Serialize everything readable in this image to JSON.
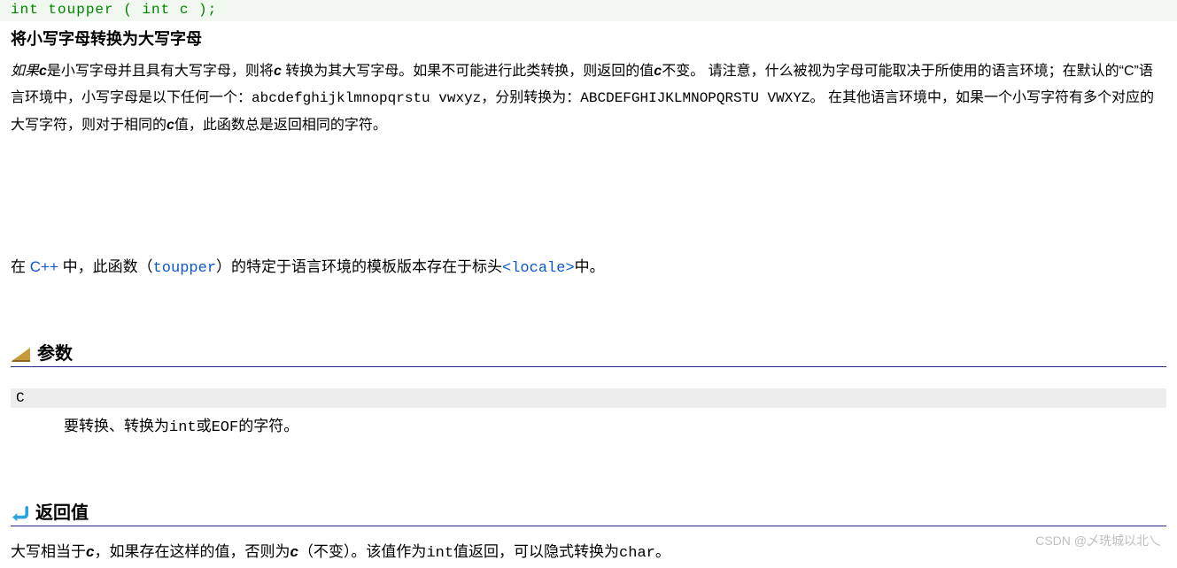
{
  "proto": {
    "full": "int toupper ( int c );"
  },
  "heading": "将小写字母转换为大写字母",
  "desc": {
    "p1_a": "如果",
    "p1_b": "c",
    "p1_c": "是小写字母并且具有大写字母，则将",
    "p1_d": "c",
    "p1_e": " 转换为其大写字母。如果不可能进行此类转换，则返回的值",
    "p1_f": "c",
    "p1_g": "不变。 请注意，什么被视为字母可能取决于所使用的语言环境；在默认的“C”语言环境中，小写字母是以下任何一个：",
    "p1_h": "abcdefghijklmnopqrstu vwxyz",
    "p1_i": "，分别转换为：",
    "p1_j": "ABCDEFGHIJKLMNOPQRSTU VWXYZ",
    "p1_k": "。 在其他语言环境中，如果一个小写字符有多个对应的大写字符，则对于相同的",
    "p1_l": "c",
    "p1_m": "值，此函数总是返回相同的字符。"
  },
  "related": {
    "pre": "在 ",
    "cpp": "C++",
    "mid1": " 中，此函数（",
    "fn": "toupper",
    "mid2": "）的特定于语言环境的模板版本存在于标头",
    "hdr": "<locale>",
    "post": "中。"
  },
  "section_params": "参数",
  "param_name": "C",
  "param_desc": {
    "a": "要转换、转换为",
    "b": "int",
    "c": "或",
    "d": "EOF",
    "e": "的字符。"
  },
  "section_return": "返回值",
  "return_desc": {
    "a": "大写相当于",
    "b": "c",
    "c": "，如果存在这样的值，否则为",
    "d": "c",
    "e": "（不变）。该值作为",
    "f": "int",
    "g": "值返回，可以隐式转换为",
    "h": "char",
    "i": "。"
  },
  "watermark": "CSDN @乄珗城以北乀"
}
